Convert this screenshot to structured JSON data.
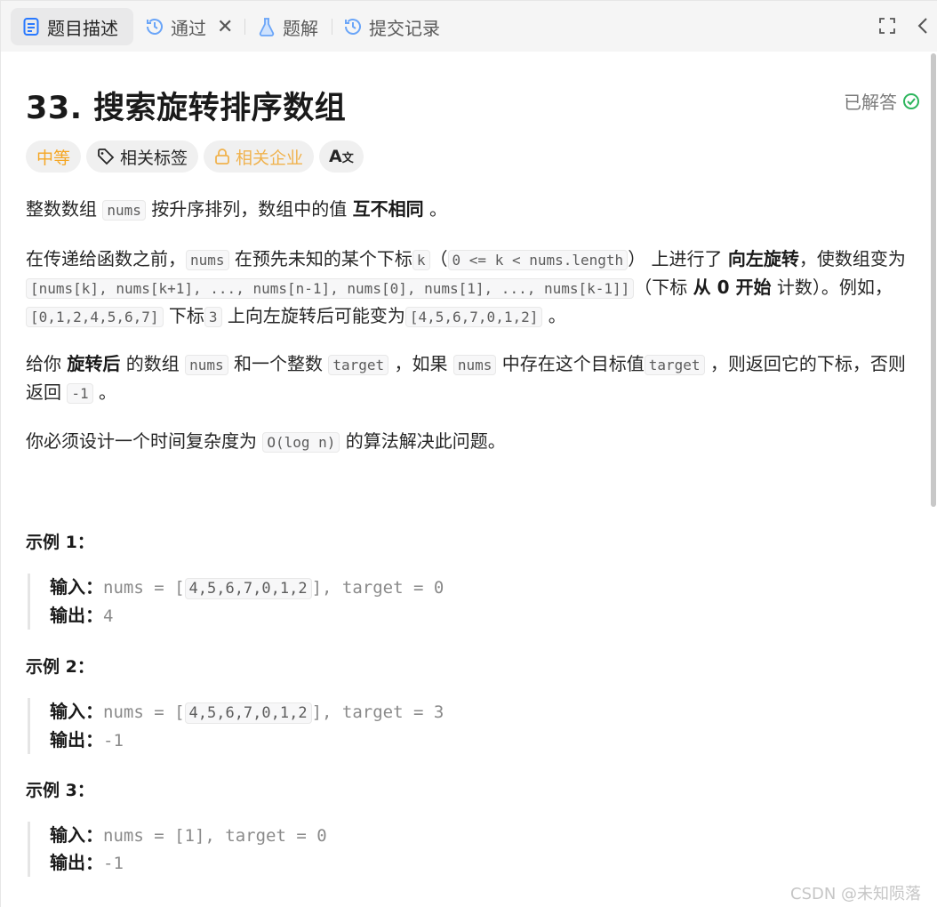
{
  "tabs": {
    "description": "题目描述",
    "passed": "通过",
    "solution": "题解",
    "submissions": "提交记录"
  },
  "problem": {
    "title": "33. 搜索旋转排序数组",
    "solved_label": "已解答",
    "difficulty": "中等",
    "tags_label": "相关标签",
    "company_label": "相关企业"
  },
  "desc": {
    "p1_a": "整数数组",
    "nums": "nums",
    "p1_b": "按升序排列，数组中的值",
    "p1_bold": "互不相同",
    "p1_end": "。",
    "p2_a": "在传递给函数之前，",
    "p2_b": "在预先未知的某个下标",
    "k": "k",
    "p2_paren_open": "（",
    "p2_cond": "0 <= k < nums.length",
    "p2_paren_close": "）",
    "p2_c": "上进行了",
    "p2_bold": "向左旋转",
    "p2_d": "，使数组变为",
    "p2_arr": "[nums[k], nums[k+1], ..., nums[n-1], nums[0], nums[1], ..., nums[k-1]]",
    "p2_e": "（下标",
    "p2_bold2": "从 0 开始",
    "p2_f": "计数）。例如，",
    "p2_ex1": "[0,1,2,4,5,6,7]",
    "p2_g": "下标",
    "p2_idx": "3",
    "p2_h": "上向左旋转后可能变为",
    "p2_ex2": "[4,5,6,7,0,1,2]",
    "p2_end": "。",
    "p3_a": "给你",
    "p3_bold": "旋转后",
    "p3_b": "的数组",
    "p3_c": "和一个整数",
    "target": "target",
    "p3_d": "，如果",
    "p3_e": "中存在这个目标值",
    "p3_f": "，则返回它的下标，否则返回",
    "minus1": "-1",
    "p3_end": "。",
    "p4_a": "你必须设计一个时间复杂度为",
    "p4_code": "O(log n)",
    "p4_b": "的算法解决此问题。"
  },
  "examples": [
    {
      "title": "示例 1：",
      "input_label": "输入：",
      "input_pre": "nums = [",
      "input_arr": "4,5,6,7,0,1,2",
      "input_post": "], target = 0",
      "output_label": "输出：",
      "output": "4"
    },
    {
      "title": "示例 2：",
      "input_label": "输入：",
      "input_pre": "nums = [",
      "input_arr": "4,5,6,7,0,1,2",
      "input_post": "], target = 3",
      "output_label": "输出：",
      "output": "-1"
    },
    {
      "title": "示例 3：",
      "input_label": "输入：",
      "input_full": "nums = [1], target = 0",
      "output_label": "输出：",
      "output": "-1"
    }
  ],
  "watermark": "CSDN @未知陨落"
}
